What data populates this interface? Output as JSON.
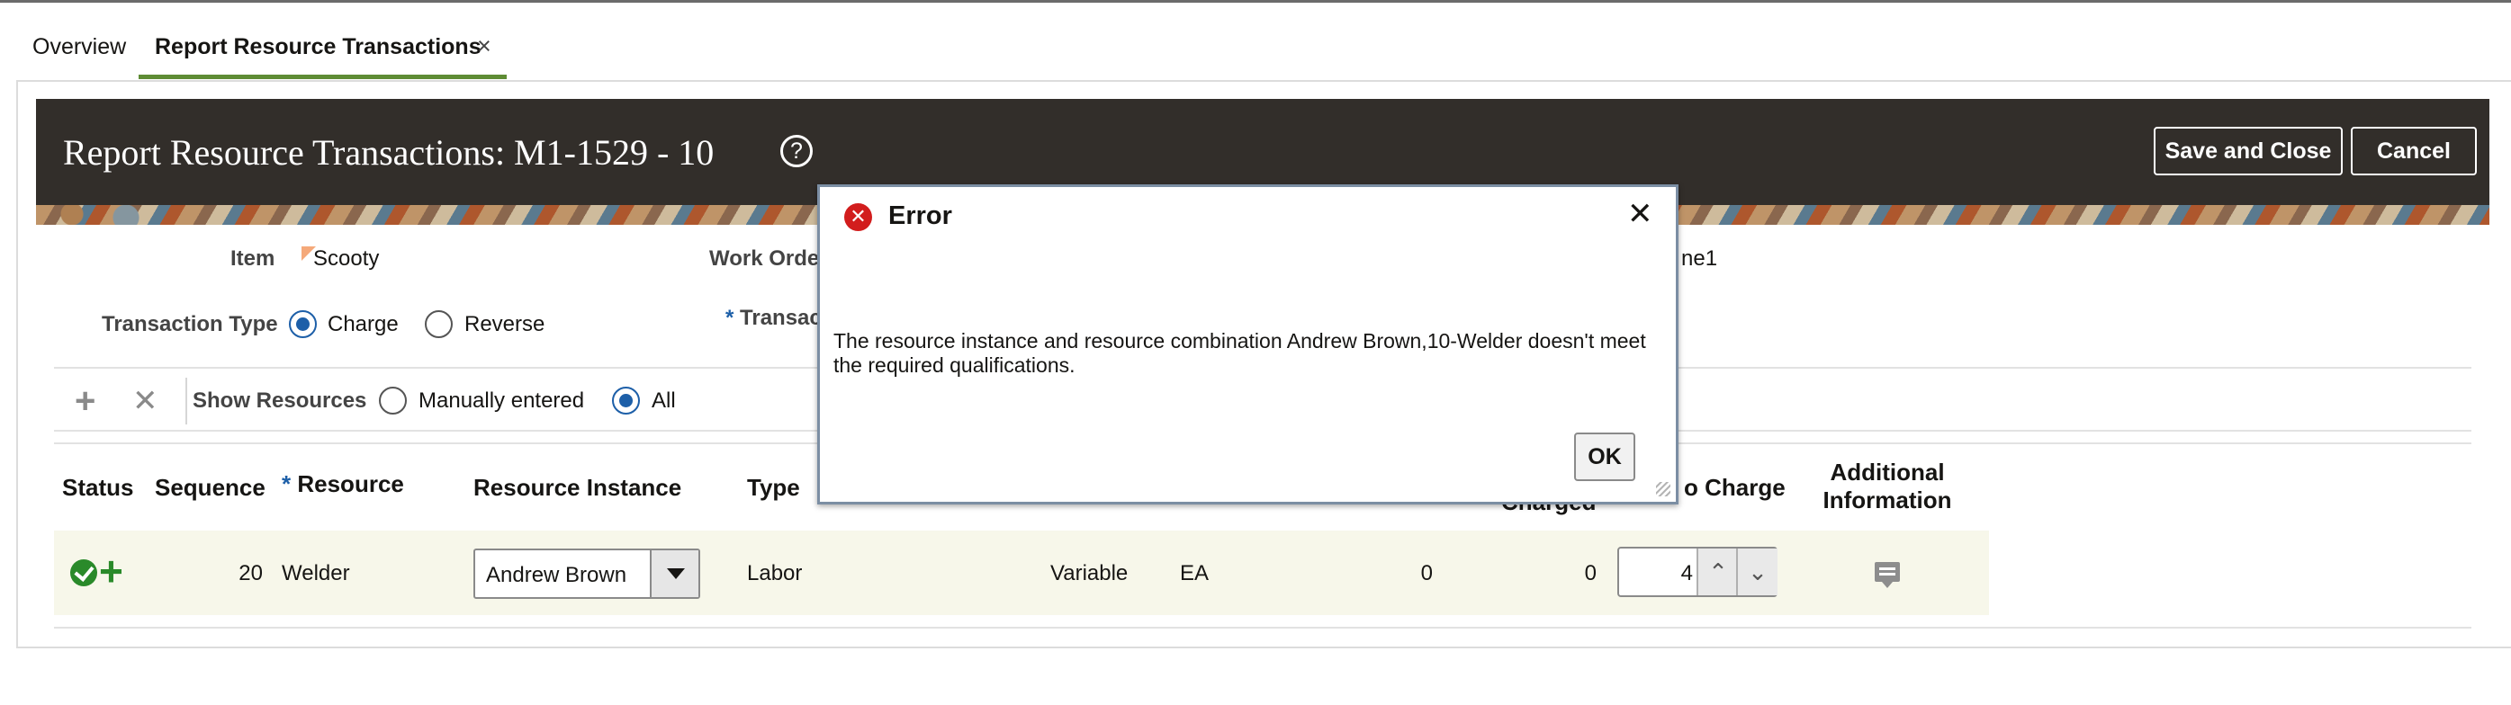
{
  "tabs": [
    {
      "label": "Overview"
    },
    {
      "label": "Report Resource Transactions",
      "close_glyph": "×"
    }
  ],
  "header": {
    "title": "Report Resource Transactions: M1-1529 - 10",
    "help_glyph": "?",
    "save_close": "Save and Close",
    "cancel": "Cancel"
  },
  "form": {
    "item_label": "Item",
    "item_value": "Scooty",
    "work_order_label": "Work Orde",
    "trailing_value": "ne1",
    "transaction_type_label": "Transaction Type",
    "charge_label": "Charge",
    "reverse_label": "Reverse",
    "selected_transaction_type": "Charge",
    "required_marker": "*",
    "transaction_date_label": "Transac"
  },
  "toolbar": {
    "add_glyph": "+",
    "delete_glyph": "✕",
    "show_resources_label": "Show Resources",
    "manual_label": "Manually entered",
    "all_label": "All",
    "selected_filter": "All"
  },
  "table": {
    "headers": {
      "status": "Status",
      "sequence": "Sequence",
      "resource": "Resource",
      "resource_instance": "Resource Instance",
      "type": "Type",
      "charged_fragment": "Charged",
      "to_charge_fragment": "o Charge",
      "additional_info_line1": "Additional",
      "additional_info_line2": "Information"
    },
    "row": {
      "plus_glyph": "+",
      "sequence": "20",
      "resource": "Welder",
      "resource_instance": "Andrew   Brown",
      "type": "Labor",
      "basis": "Variable",
      "uom": "EA",
      "required": "0",
      "charged": "0",
      "to_charge": "4",
      "up_glyph": "⌃",
      "down_glyph": "⌄"
    }
  },
  "dialog": {
    "title": "Error",
    "error_glyph": "✕",
    "close_glyph": "✕",
    "message": "The resource instance and resource combination Andrew Brown,10-Welder doesn't meet the required qualifications.",
    "ok": "OK"
  },
  "colors": {
    "header_bg": "#322e2a",
    "accent_green": "#5e8c34",
    "radio_blue": "#1d5fa8",
    "error_red": "#d21d1d",
    "row_highlight": "#f7f7ea"
  }
}
